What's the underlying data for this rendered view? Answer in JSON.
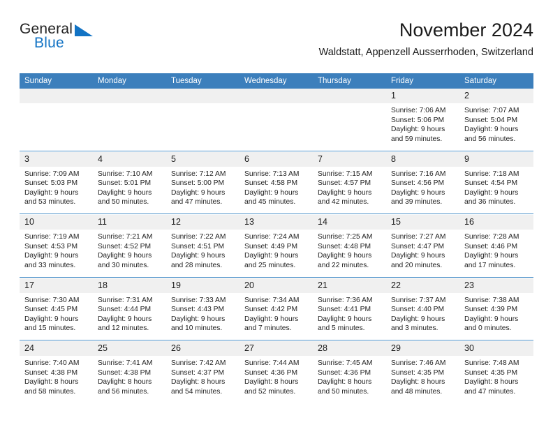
{
  "brand": {
    "word_one": "General",
    "word_two": "Blue",
    "triangle_color": "#1273c4"
  },
  "header": {
    "title": "November 2024",
    "subtitle": "Waldstatt, Appenzell Ausserrhoden, Switzerland"
  },
  "theme": {
    "header_blue": "#3c7fbc",
    "daynum_gray": "#f0f0f0",
    "separator_blue": "#4a90c9",
    "text": "#222222"
  },
  "calendar": {
    "weekday_headers": [
      "Sunday",
      "Monday",
      "Tuesday",
      "Wednesday",
      "Thursday",
      "Friday",
      "Saturday"
    ],
    "weeks": [
      [
        {
          "day": "",
          "sunrise": "",
          "sunset": "",
          "daylight_a": "",
          "daylight_b": ""
        },
        {
          "day": "",
          "sunrise": "",
          "sunset": "",
          "daylight_a": "",
          "daylight_b": ""
        },
        {
          "day": "",
          "sunrise": "",
          "sunset": "",
          "daylight_a": "",
          "daylight_b": ""
        },
        {
          "day": "",
          "sunrise": "",
          "sunset": "",
          "daylight_a": "",
          "daylight_b": ""
        },
        {
          "day": "",
          "sunrise": "",
          "sunset": "",
          "daylight_a": "",
          "daylight_b": ""
        },
        {
          "day": "1",
          "sunrise": "Sunrise: 7:06 AM",
          "sunset": "Sunset: 5:06 PM",
          "daylight_a": "Daylight: 9 hours",
          "daylight_b": "and 59 minutes."
        },
        {
          "day": "2",
          "sunrise": "Sunrise: 7:07 AM",
          "sunset": "Sunset: 5:04 PM",
          "daylight_a": "Daylight: 9 hours",
          "daylight_b": "and 56 minutes."
        }
      ],
      [
        {
          "day": "3",
          "sunrise": "Sunrise: 7:09 AM",
          "sunset": "Sunset: 5:03 PM",
          "daylight_a": "Daylight: 9 hours",
          "daylight_b": "and 53 minutes."
        },
        {
          "day": "4",
          "sunrise": "Sunrise: 7:10 AM",
          "sunset": "Sunset: 5:01 PM",
          "daylight_a": "Daylight: 9 hours",
          "daylight_b": "and 50 minutes."
        },
        {
          "day": "5",
          "sunrise": "Sunrise: 7:12 AM",
          "sunset": "Sunset: 5:00 PM",
          "daylight_a": "Daylight: 9 hours",
          "daylight_b": "and 47 minutes."
        },
        {
          "day": "6",
          "sunrise": "Sunrise: 7:13 AM",
          "sunset": "Sunset: 4:58 PM",
          "daylight_a": "Daylight: 9 hours",
          "daylight_b": "and 45 minutes."
        },
        {
          "day": "7",
          "sunrise": "Sunrise: 7:15 AM",
          "sunset": "Sunset: 4:57 PM",
          "daylight_a": "Daylight: 9 hours",
          "daylight_b": "and 42 minutes."
        },
        {
          "day": "8",
          "sunrise": "Sunrise: 7:16 AM",
          "sunset": "Sunset: 4:56 PM",
          "daylight_a": "Daylight: 9 hours",
          "daylight_b": "and 39 minutes."
        },
        {
          "day": "9",
          "sunrise": "Sunrise: 7:18 AM",
          "sunset": "Sunset: 4:54 PM",
          "daylight_a": "Daylight: 9 hours",
          "daylight_b": "and 36 minutes."
        }
      ],
      [
        {
          "day": "10",
          "sunrise": "Sunrise: 7:19 AM",
          "sunset": "Sunset: 4:53 PM",
          "daylight_a": "Daylight: 9 hours",
          "daylight_b": "and 33 minutes."
        },
        {
          "day": "11",
          "sunrise": "Sunrise: 7:21 AM",
          "sunset": "Sunset: 4:52 PM",
          "daylight_a": "Daylight: 9 hours",
          "daylight_b": "and 30 minutes."
        },
        {
          "day": "12",
          "sunrise": "Sunrise: 7:22 AM",
          "sunset": "Sunset: 4:51 PM",
          "daylight_a": "Daylight: 9 hours",
          "daylight_b": "and 28 minutes."
        },
        {
          "day": "13",
          "sunrise": "Sunrise: 7:24 AM",
          "sunset": "Sunset: 4:49 PM",
          "daylight_a": "Daylight: 9 hours",
          "daylight_b": "and 25 minutes."
        },
        {
          "day": "14",
          "sunrise": "Sunrise: 7:25 AM",
          "sunset": "Sunset: 4:48 PM",
          "daylight_a": "Daylight: 9 hours",
          "daylight_b": "and 22 minutes."
        },
        {
          "day": "15",
          "sunrise": "Sunrise: 7:27 AM",
          "sunset": "Sunset: 4:47 PM",
          "daylight_a": "Daylight: 9 hours",
          "daylight_b": "and 20 minutes."
        },
        {
          "day": "16",
          "sunrise": "Sunrise: 7:28 AM",
          "sunset": "Sunset: 4:46 PM",
          "daylight_a": "Daylight: 9 hours",
          "daylight_b": "and 17 minutes."
        }
      ],
      [
        {
          "day": "17",
          "sunrise": "Sunrise: 7:30 AM",
          "sunset": "Sunset: 4:45 PM",
          "daylight_a": "Daylight: 9 hours",
          "daylight_b": "and 15 minutes."
        },
        {
          "day": "18",
          "sunrise": "Sunrise: 7:31 AM",
          "sunset": "Sunset: 4:44 PM",
          "daylight_a": "Daylight: 9 hours",
          "daylight_b": "and 12 minutes."
        },
        {
          "day": "19",
          "sunrise": "Sunrise: 7:33 AM",
          "sunset": "Sunset: 4:43 PM",
          "daylight_a": "Daylight: 9 hours",
          "daylight_b": "and 10 minutes."
        },
        {
          "day": "20",
          "sunrise": "Sunrise: 7:34 AM",
          "sunset": "Sunset: 4:42 PM",
          "daylight_a": "Daylight: 9 hours",
          "daylight_b": "and 7 minutes."
        },
        {
          "day": "21",
          "sunrise": "Sunrise: 7:36 AM",
          "sunset": "Sunset: 4:41 PM",
          "daylight_a": "Daylight: 9 hours",
          "daylight_b": "and 5 minutes."
        },
        {
          "day": "22",
          "sunrise": "Sunrise: 7:37 AM",
          "sunset": "Sunset: 4:40 PM",
          "daylight_a": "Daylight: 9 hours",
          "daylight_b": "and 3 minutes."
        },
        {
          "day": "23",
          "sunrise": "Sunrise: 7:38 AM",
          "sunset": "Sunset: 4:39 PM",
          "daylight_a": "Daylight: 9 hours",
          "daylight_b": "and 0 minutes."
        }
      ],
      [
        {
          "day": "24",
          "sunrise": "Sunrise: 7:40 AM",
          "sunset": "Sunset: 4:38 PM",
          "daylight_a": "Daylight: 8 hours",
          "daylight_b": "and 58 minutes."
        },
        {
          "day": "25",
          "sunrise": "Sunrise: 7:41 AM",
          "sunset": "Sunset: 4:38 PM",
          "daylight_a": "Daylight: 8 hours",
          "daylight_b": "and 56 minutes."
        },
        {
          "day": "26",
          "sunrise": "Sunrise: 7:42 AM",
          "sunset": "Sunset: 4:37 PM",
          "daylight_a": "Daylight: 8 hours",
          "daylight_b": "and 54 minutes."
        },
        {
          "day": "27",
          "sunrise": "Sunrise: 7:44 AM",
          "sunset": "Sunset: 4:36 PM",
          "daylight_a": "Daylight: 8 hours",
          "daylight_b": "and 52 minutes."
        },
        {
          "day": "28",
          "sunrise": "Sunrise: 7:45 AM",
          "sunset": "Sunset: 4:36 PM",
          "daylight_a": "Daylight: 8 hours",
          "daylight_b": "and 50 minutes."
        },
        {
          "day": "29",
          "sunrise": "Sunrise: 7:46 AM",
          "sunset": "Sunset: 4:35 PM",
          "daylight_a": "Daylight: 8 hours",
          "daylight_b": "and 48 minutes."
        },
        {
          "day": "30",
          "sunrise": "Sunrise: 7:48 AM",
          "sunset": "Sunset: 4:35 PM",
          "daylight_a": "Daylight: 8 hours",
          "daylight_b": "and 47 minutes."
        }
      ]
    ]
  }
}
